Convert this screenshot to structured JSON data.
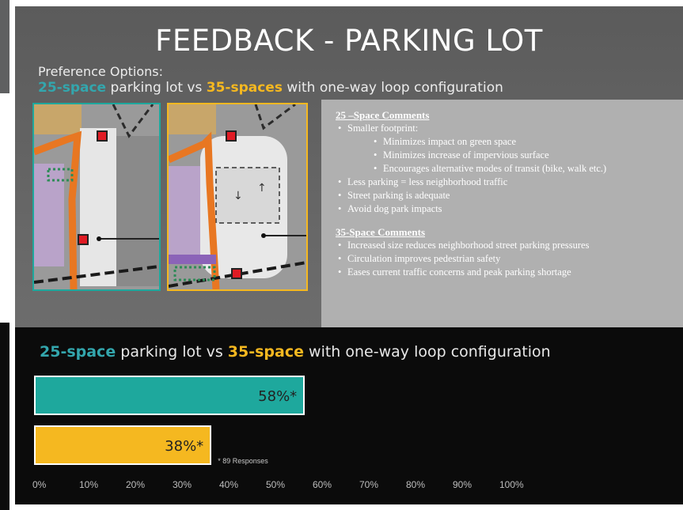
{
  "title": "FEEDBACK - PARKING LOT",
  "preference": {
    "label": "Preference Options:",
    "option_a": "25-space",
    "mid_a": " parking lot vs ",
    "option_b": "35-spaces",
    "tail": " with one-way loop configuration"
  },
  "comments": {
    "heading_25": "25 –Space Comments",
    "items_25": [
      "Smaller footprint:",
      "Minimizes impact on green space",
      "Minimizes increase of impervious surface",
      "Encourages alternative modes of transit (bike, walk etc.)",
      "Less parking = less neighborhood traffic",
      "Street parking is adequate",
      "Avoid dog park impacts"
    ],
    "heading_35": "35-Space Comments",
    "items_35": [
      "Increased size reduces neighborhood street parking pressures",
      "Circulation improves pedestrian safety",
      "Eases current traffic concerns and peak parking shortage"
    ]
  },
  "chart_title": {
    "option_a": "25-space",
    "mid": " parking lot vs ",
    "option_b": "35-space",
    "tail": " with one-way loop configuration"
  },
  "colors": {
    "teal": "#1ea89d",
    "gold": "#f5b820",
    "teal_text": "#33a6ad"
  },
  "chart_data": {
    "type": "bar",
    "orientation": "horizontal",
    "categories": [
      "25-space parking lot",
      "35-space with one-way loop configuration"
    ],
    "values": [
      58,
      38
    ],
    "value_labels": [
      "58%*",
      "38%*"
    ],
    "colors": [
      "#1ea89d",
      "#f5b820"
    ],
    "xlim": [
      0,
      100
    ],
    "x_ticks": [
      "0%",
      "10%",
      "20%",
      "30%",
      "40%",
      "50%",
      "60%",
      "70%",
      "80%",
      "90%",
      "100%"
    ],
    "note": "* 89 Responses"
  }
}
